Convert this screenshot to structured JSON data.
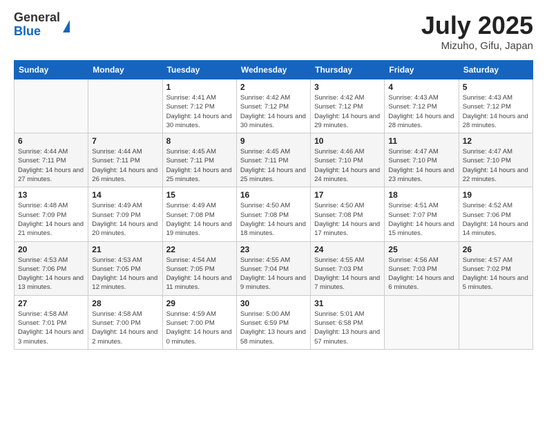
{
  "header": {
    "logo_general": "General",
    "logo_blue": "Blue",
    "month_title": "July 2025",
    "subtitle": "Mizuho, Gifu, Japan"
  },
  "weekdays": [
    "Sunday",
    "Monday",
    "Tuesday",
    "Wednesday",
    "Thursday",
    "Friday",
    "Saturday"
  ],
  "weeks": [
    [
      {
        "day": "",
        "empty": true
      },
      {
        "day": "",
        "empty": true
      },
      {
        "day": "1",
        "sunrise": "4:41 AM",
        "sunset": "7:12 PM",
        "daylight": "14 hours and 30 minutes."
      },
      {
        "day": "2",
        "sunrise": "4:42 AM",
        "sunset": "7:12 PM",
        "daylight": "14 hours and 30 minutes."
      },
      {
        "day": "3",
        "sunrise": "4:42 AM",
        "sunset": "7:12 PM",
        "daylight": "14 hours and 29 minutes."
      },
      {
        "day": "4",
        "sunrise": "4:43 AM",
        "sunset": "7:12 PM",
        "daylight": "14 hours and 28 minutes."
      },
      {
        "day": "5",
        "sunrise": "4:43 AM",
        "sunset": "7:12 PM",
        "daylight": "14 hours and 28 minutes."
      }
    ],
    [
      {
        "day": "6",
        "sunrise": "4:44 AM",
        "sunset": "7:11 PM",
        "daylight": "14 hours and 27 minutes."
      },
      {
        "day": "7",
        "sunrise": "4:44 AM",
        "sunset": "7:11 PM",
        "daylight": "14 hours and 26 minutes."
      },
      {
        "day": "8",
        "sunrise": "4:45 AM",
        "sunset": "7:11 PM",
        "daylight": "14 hours and 25 minutes."
      },
      {
        "day": "9",
        "sunrise": "4:45 AM",
        "sunset": "7:11 PM",
        "daylight": "14 hours and 25 minutes."
      },
      {
        "day": "10",
        "sunrise": "4:46 AM",
        "sunset": "7:10 PM",
        "daylight": "14 hours and 24 minutes."
      },
      {
        "day": "11",
        "sunrise": "4:47 AM",
        "sunset": "7:10 PM",
        "daylight": "14 hours and 23 minutes."
      },
      {
        "day": "12",
        "sunrise": "4:47 AM",
        "sunset": "7:10 PM",
        "daylight": "14 hours and 22 minutes."
      }
    ],
    [
      {
        "day": "13",
        "sunrise": "4:48 AM",
        "sunset": "7:09 PM",
        "daylight": "14 hours and 21 minutes."
      },
      {
        "day": "14",
        "sunrise": "4:49 AM",
        "sunset": "7:09 PM",
        "daylight": "14 hours and 20 minutes."
      },
      {
        "day": "15",
        "sunrise": "4:49 AM",
        "sunset": "7:08 PM",
        "daylight": "14 hours and 19 minutes."
      },
      {
        "day": "16",
        "sunrise": "4:50 AM",
        "sunset": "7:08 PM",
        "daylight": "14 hours and 18 minutes."
      },
      {
        "day": "17",
        "sunrise": "4:50 AM",
        "sunset": "7:08 PM",
        "daylight": "14 hours and 17 minutes."
      },
      {
        "day": "18",
        "sunrise": "4:51 AM",
        "sunset": "7:07 PM",
        "daylight": "14 hours and 15 minutes."
      },
      {
        "day": "19",
        "sunrise": "4:52 AM",
        "sunset": "7:06 PM",
        "daylight": "14 hours and 14 minutes."
      }
    ],
    [
      {
        "day": "20",
        "sunrise": "4:53 AM",
        "sunset": "7:06 PM",
        "daylight": "14 hours and 13 minutes."
      },
      {
        "day": "21",
        "sunrise": "4:53 AM",
        "sunset": "7:05 PM",
        "daylight": "14 hours and 12 minutes."
      },
      {
        "day": "22",
        "sunrise": "4:54 AM",
        "sunset": "7:05 PM",
        "daylight": "14 hours and 11 minutes."
      },
      {
        "day": "23",
        "sunrise": "4:55 AM",
        "sunset": "7:04 PM",
        "daylight": "14 hours and 9 minutes."
      },
      {
        "day": "24",
        "sunrise": "4:55 AM",
        "sunset": "7:03 PM",
        "daylight": "14 hours and 7 minutes."
      },
      {
        "day": "25",
        "sunrise": "4:56 AM",
        "sunset": "7:03 PM",
        "daylight": "14 hours and 6 minutes."
      },
      {
        "day": "26",
        "sunrise": "4:57 AM",
        "sunset": "7:02 PM",
        "daylight": "14 hours and 5 minutes."
      }
    ],
    [
      {
        "day": "27",
        "sunrise": "4:58 AM",
        "sunset": "7:01 PM",
        "daylight": "14 hours and 3 minutes."
      },
      {
        "day": "28",
        "sunrise": "4:58 AM",
        "sunset": "7:00 PM",
        "daylight": "14 hours and 2 minutes."
      },
      {
        "day": "29",
        "sunrise": "4:59 AM",
        "sunset": "7:00 PM",
        "daylight": "14 hours and 0 minutes."
      },
      {
        "day": "30",
        "sunrise": "5:00 AM",
        "sunset": "6:59 PM",
        "daylight": "13 hours and 58 minutes."
      },
      {
        "day": "31",
        "sunrise": "5:01 AM",
        "sunset": "6:58 PM",
        "daylight": "13 hours and 57 minutes."
      },
      {
        "day": "",
        "empty": true
      },
      {
        "day": "",
        "empty": true
      }
    ]
  ],
  "labels": {
    "sunrise": "Sunrise:",
    "sunset": "Sunset:",
    "daylight": "Daylight:"
  }
}
